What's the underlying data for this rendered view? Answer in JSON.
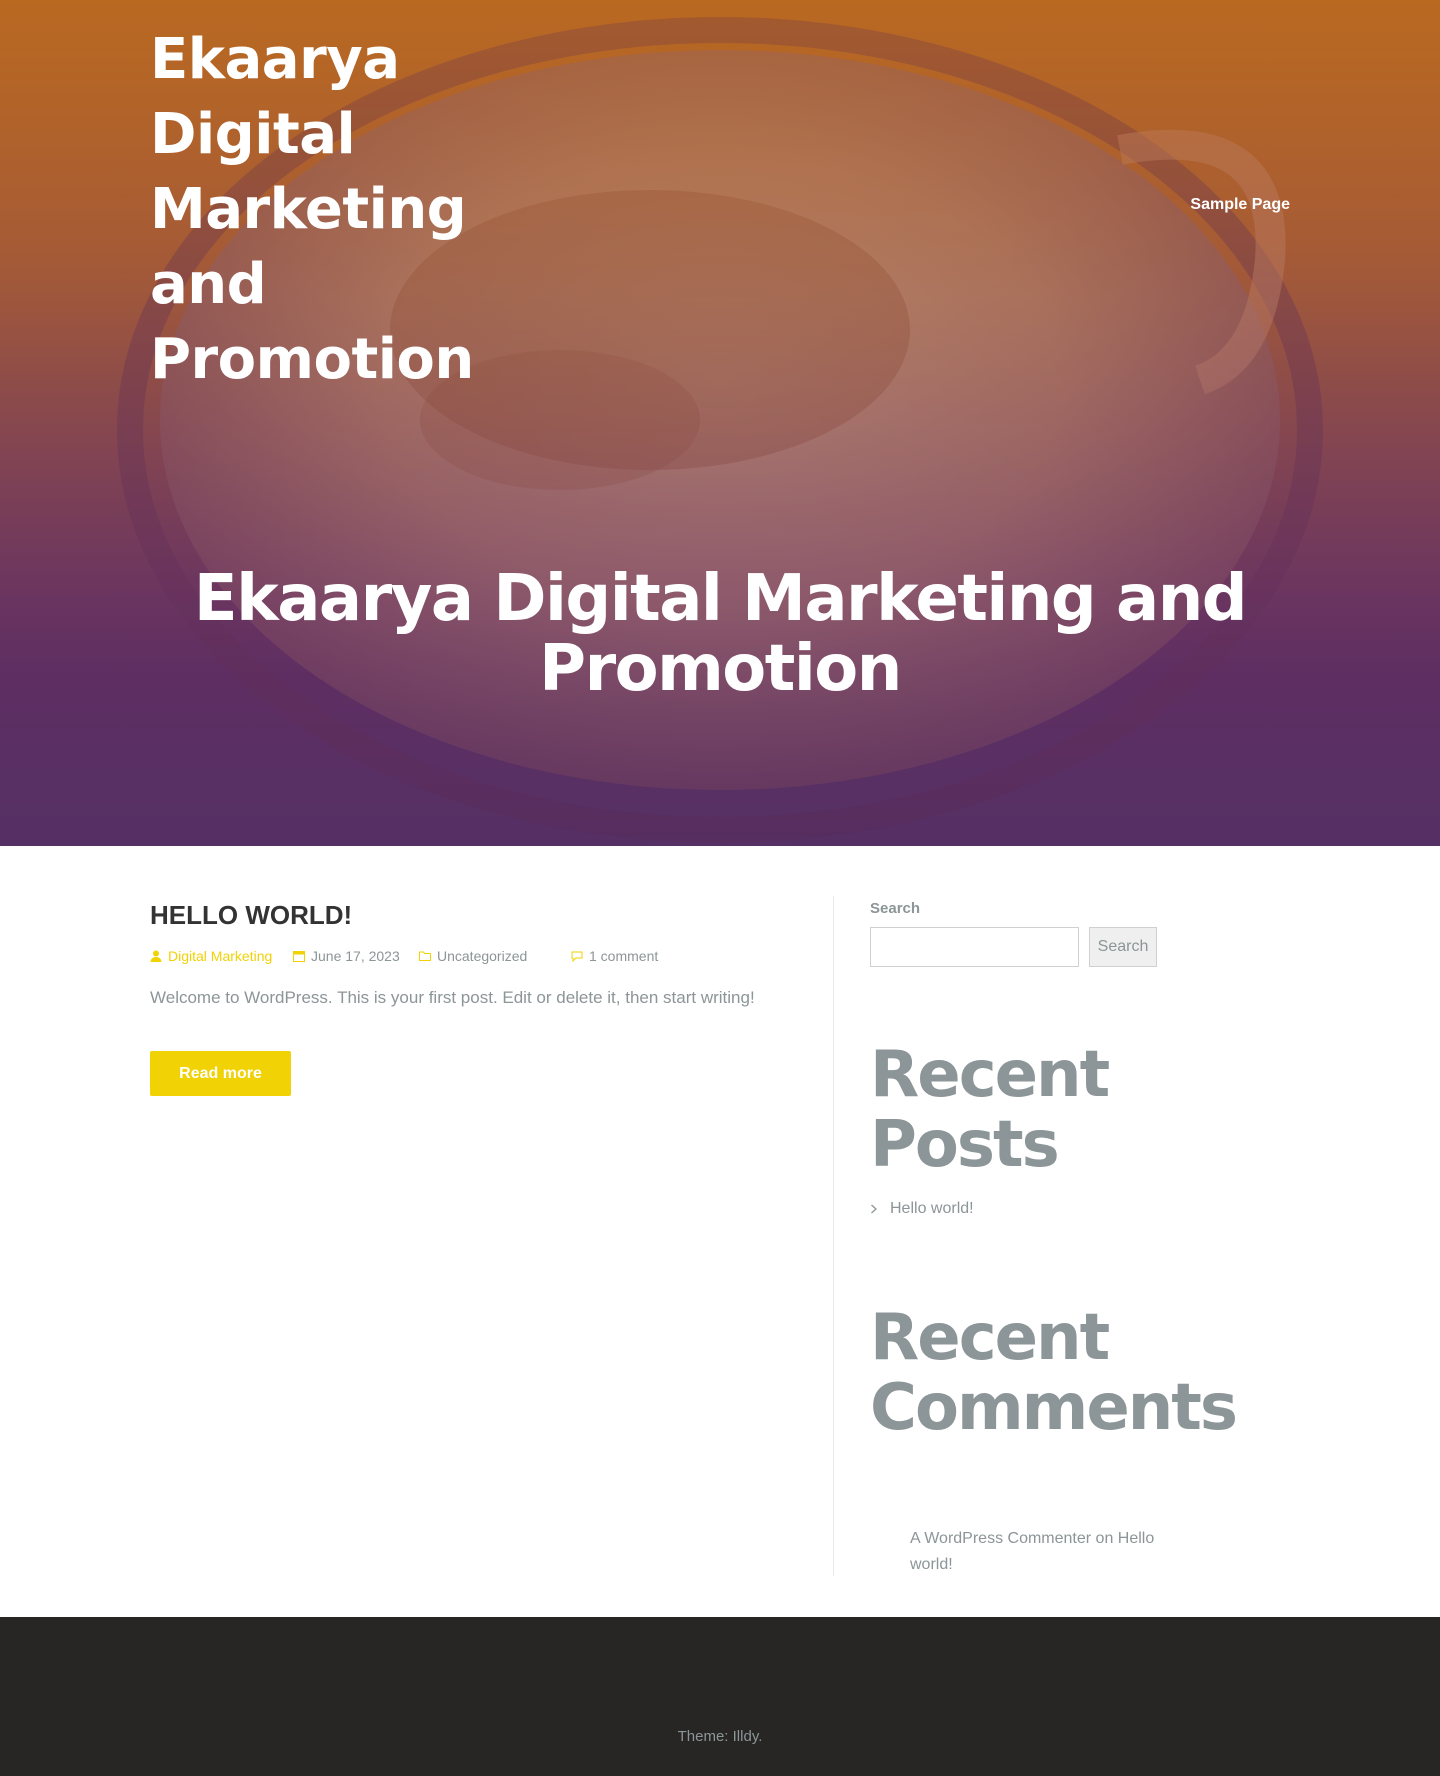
{
  "header": {
    "site_title": "Ekaarya Digital Marketing and Promotion",
    "nav": {
      "sample_page": "Sample Page"
    },
    "hero_heading": "Ekaarya Digital Marketing and Promotion"
  },
  "post": {
    "title": "HELLO WORLD!",
    "meta": {
      "author": "Digital Marketing",
      "date": "June 17, 2023",
      "category": "Uncategorized",
      "comments": "1 comment"
    },
    "excerpt": "Welcome to WordPress. This is your first post. Edit or delete it, then start writing!",
    "read_more": "Read more"
  },
  "sidebar": {
    "search": {
      "label": "Search",
      "placeholder": "",
      "button": "Search"
    },
    "recent_posts": {
      "title": "Recent Posts",
      "items": [
        "Hello world!"
      ]
    },
    "recent_comments": {
      "title": "Recent Comments",
      "items": [
        {
          "author": "A WordPress Commenter",
          "connector": "on",
          "post": "Hello world!"
        }
      ]
    }
  },
  "footer": {
    "text": "Theme: Illdy."
  },
  "colors": {
    "accent": "#f1d204",
    "footer_bg": "#272624",
    "text_muted": "#8c9597"
  }
}
